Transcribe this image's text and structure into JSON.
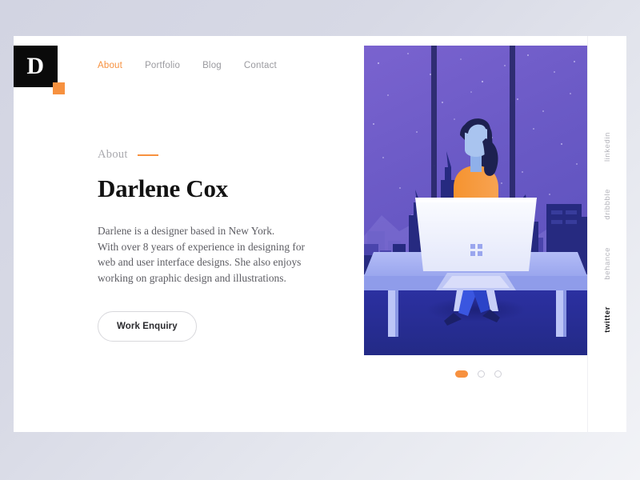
{
  "theme": {
    "accent": "#f7913f",
    "ink": "#121212",
    "muted": "#9a9a9f",
    "card_bg": "#ffffff",
    "page_bg_start": "#d2d4e2",
    "page_bg_end": "#f2f3f7"
  },
  "logo": {
    "letter": "D",
    "accent_color": "#f7913f"
  },
  "nav": {
    "items": [
      {
        "label": "About",
        "active": true
      },
      {
        "label": "Portfolio",
        "active": false
      },
      {
        "label": "Blog",
        "active": false
      },
      {
        "label": "Contact",
        "active": false
      }
    ]
  },
  "hero": {
    "eyebrow": "About",
    "headline": "Darlene Cox",
    "bio_lines": [
      "Darlene is a designer based in New York.",
      "With over 8 years of experience in designing for",
      "web and user interface designs. She also enjoys",
      "working on graphic design and illustrations."
    ],
    "cta_label": "Work Enquiry"
  },
  "carousel": {
    "slides": [
      {
        "index": 1,
        "active": true
      },
      {
        "index": 2,
        "active": false
      },
      {
        "index": 3,
        "active": false
      }
    ]
  },
  "social": {
    "items": [
      {
        "label": "linkedin",
        "active": false
      },
      {
        "label": "dribbble",
        "active": false
      },
      {
        "label": "behance",
        "active": false
      },
      {
        "label": "twitter",
        "active": true
      }
    ]
  },
  "illustration": {
    "name": "woman-at-desk-night-cityscape",
    "sky_color": "#6b5bc4",
    "floor_color": "#2b2f9e",
    "desk_color": "#a9b4f2",
    "shirt_color": "#f7913f",
    "hair_color": "#1d2150",
    "monitor_color": "#f3f4fb"
  }
}
